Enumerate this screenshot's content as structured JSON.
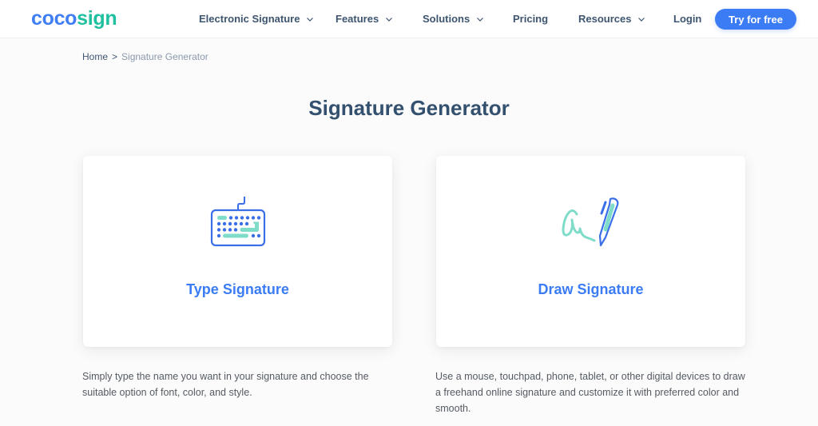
{
  "brand": {
    "part1": "coco",
    "part2": "sign",
    "color1": "#3f7ef5",
    "color2": "#1fc0a0"
  },
  "nav": {
    "items": [
      {
        "label": "Electronic Signature",
        "has_dropdown": true
      },
      {
        "label": "Features",
        "has_dropdown": true
      },
      {
        "label": "Solutions",
        "has_dropdown": true
      },
      {
        "label": "Pricing",
        "has_dropdown": false
      },
      {
        "label": "Resources",
        "has_dropdown": true
      }
    ],
    "login": "Login",
    "cta": "Try for free"
  },
  "breadcrumb": {
    "home": "Home",
    "separator": ">",
    "current": "Signature Generator"
  },
  "page": {
    "title": "Signature Generator"
  },
  "options": [
    {
      "title": "Type Signature",
      "icon": "keyboard-icon",
      "description": "Simply type the name you want in your signature and choose the suitable option of font, color, and style."
    },
    {
      "title": "Draw Signature",
      "icon": "pen-signature-icon",
      "description": "Use a mouse, touchpad, phone, tablet, or other digital devices to draw a freehand online signature and customize it with preferred color and smooth."
    }
  ],
  "colors": {
    "accent": "#3b7cf5",
    "teal": "#7fdcc9",
    "title": "#34506f"
  }
}
